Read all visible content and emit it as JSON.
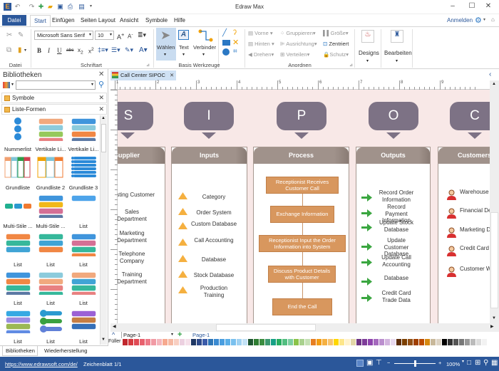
{
  "app": {
    "title": "Edraw Max"
  },
  "quick_access": [
    "app-logo-icon",
    "undo-icon",
    "redo-icon",
    "new-icon",
    "open-icon",
    "save-icon",
    "print-icon",
    "export-icon",
    "customize-icon"
  ],
  "window_controls": {
    "minimize": "–",
    "maximize": "☐",
    "close": "✕"
  },
  "menu": {
    "tabs": [
      "Datei",
      "Start",
      "Einfügen",
      "Seiten Layout",
      "Ansicht",
      "Symbole",
      "Hilfe"
    ],
    "active": "Start",
    "sign_in": "Anmelden"
  },
  "ribbon": {
    "groups": {
      "datei": "Datei",
      "schriftart": "Schriftart",
      "basis": "Basis Werkzeuge",
      "anordnen": "Anordnen"
    },
    "font_name": "Microsoft Sans Serif",
    "font_size": "10",
    "tools": {
      "select": "Wählen",
      "text": "Text",
      "connector": "Verbinder"
    },
    "arrange": {
      "front": "Vorne",
      "back": "Hinten",
      "rotate": "Drehen",
      "group": "Gruppieren",
      "align": "Ausrichtung",
      "distribute": "Verteilen",
      "size": "Größe",
      "center": "Zentriert",
      "protect": "Schutz"
    },
    "designs": "Designs",
    "edit": "Bearbeiten"
  },
  "libraries": {
    "title": "Bibliotheken",
    "search_placeholder": "",
    "sections": [
      "Symbole",
      "Liste-Formen"
    ],
    "shapes": [
      "Nummerlist",
      "Vertikale Li...",
      "Vertikale Li...",
      "Grundliste",
      "Grundliste 2",
      "Grundliste 3",
      "Multi-Stile ...",
      "Multi-Stile ...",
      "List",
      "List",
      "List",
      "List",
      "List",
      "List",
      "List",
      "List",
      "List",
      "List"
    ],
    "bottom_tabs": [
      "Bibliotheken",
      "Wiederherstellung"
    ]
  },
  "document": {
    "tab": "Call Center SIPOC",
    "ruler_marks": [
      "1",
      "2",
      "3",
      "4",
      "5",
      "6",
      "7",
      "8",
      "9"
    ],
    "letters": [
      "S",
      "I",
      "P",
      "O",
      "C"
    ],
    "columns": {
      "supplier": {
        "header": "Supplier",
        "items": [
          "Existing Customer",
          "Sales Department",
          "Marketing Department",
          "Telephone Company",
          "Training Department"
        ]
      },
      "inputs": {
        "header": "Inputs",
        "items": [
          "Category",
          "Order System",
          "Custom Database",
          "Call Accounting",
          "Database",
          "Stock Database",
          "Production Training"
        ]
      },
      "process": {
        "header": "Process",
        "items": [
          "Receptionist Receives Customer Call",
          "Exchange Information",
          "Receptionist Input the Order Information into System",
          "Discuss Product Details with Customer",
          "End the Call"
        ]
      },
      "outputs": {
        "header": "Outputs",
        "items": [
          "Record Order Information",
          "Record Payment Information",
          "Update Stock Database",
          "Update Customer Database",
          "Update Call Accounting",
          "Database",
          "Credit Card Trade Data"
        ]
      },
      "customers": {
        "header": "Customers",
        "items": [
          "Warehouse Department",
          "Financial Department",
          "Marketing Department",
          "Credit Card Processor",
          "Customer Who Called"
        ]
      }
    }
  },
  "pages": {
    "current": "Page-1",
    "tabs": [
      "Page-1"
    ],
    "fill_label": "Füller"
  },
  "palette": [
    "#c0272d",
    "#d63a3f",
    "#e04a55",
    "#e8616e",
    "#ed7a88",
    "#f19aa4",
    "#f4b6bd",
    "#f6a98f",
    "#f5b9a3",
    "#f8cfc2",
    "#ecd0e0",
    "#f5e0ea",
    "#1f3864",
    "#2e4a8a",
    "#3b5ba9",
    "#2e75b6",
    "#3a8ad1",
    "#4a9ee0",
    "#5bafe8",
    "#79c0ee",
    "#9fd1f2",
    "#c3e2f6",
    "#1e5631",
    "#2e7d32",
    "#3c8d40",
    "#3d9970",
    "#16a085",
    "#27ae60",
    "#52be80",
    "#7dcea0",
    "#8bc34a",
    "#a9d18e",
    "#c5e0b4",
    "#e67e22",
    "#f39c12",
    "#f5b041",
    "#f8c471",
    "#ffd700",
    "#fde68a",
    "#fff2cc",
    "#e2d7a8",
    "#6c3483",
    "#7d3c98",
    "#8e44ad",
    "#a569bd",
    "#bb8fce",
    "#d2b4de",
    "#e8daef",
    "#5d2e0c",
    "#7b3f00",
    "#935116",
    "#a04000",
    "#ba4a00",
    "#d68910",
    "#c8b89a",
    "#dcd3c4",
    "#000000",
    "#333333",
    "#555555",
    "#777777",
    "#999999",
    "#bbbbbb",
    "#dddddd",
    "#f2f2f2"
  ],
  "status": {
    "url": "https://www.edrawsoft.com/de/",
    "sheet": "Zeichenblatt 1/1",
    "zoom": "100%",
    "zoom_level": 0.5
  },
  "colors": {
    "accent": "#2b579a",
    "letter_bg": "#7d7285",
    "header_bg": "#a0928b",
    "process_box": "#d8975e",
    "canvas_bg": "#f8e8e7"
  }
}
